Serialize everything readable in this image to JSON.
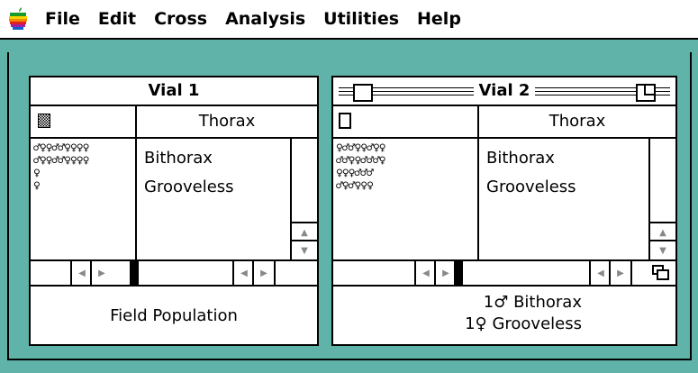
{
  "menubar": {
    "apple_icon": "apple-logo-icon",
    "items": [
      "File",
      "Edit",
      "Cross",
      "Analysis",
      "Utilities",
      "Help"
    ]
  },
  "vial1": {
    "title": "Vial 1",
    "header_label": "Thorax",
    "flies_text": "♂♀♀♂♂♀♀♀♀\n♂♀♀♂♂♀♀♀♀\n♀\n♀",
    "phenotypes": [
      "Bithorax",
      "Grooveless"
    ],
    "footer": "Field Population"
  },
  "vial2": {
    "title": "Vial 2",
    "header_label": "Thorax",
    "flies_text": "♀♂♂♀♀♂♀♀\n♂♂♀♀♂♂♂♀\n♀♀♀♂♂♂\n♂♀♂♀♀♀",
    "phenotypes": [
      "Bithorax",
      "Grooveless"
    ],
    "offspring": [
      {
        "count_sex": "1♂",
        "label": "Bithorax"
      },
      {
        "count_sex": "1♀",
        "label": "Grooveless"
      }
    ]
  },
  "colors": {
    "desktop": "#5fb3a8",
    "window": "#ffffff",
    "ink": "#000000"
  }
}
